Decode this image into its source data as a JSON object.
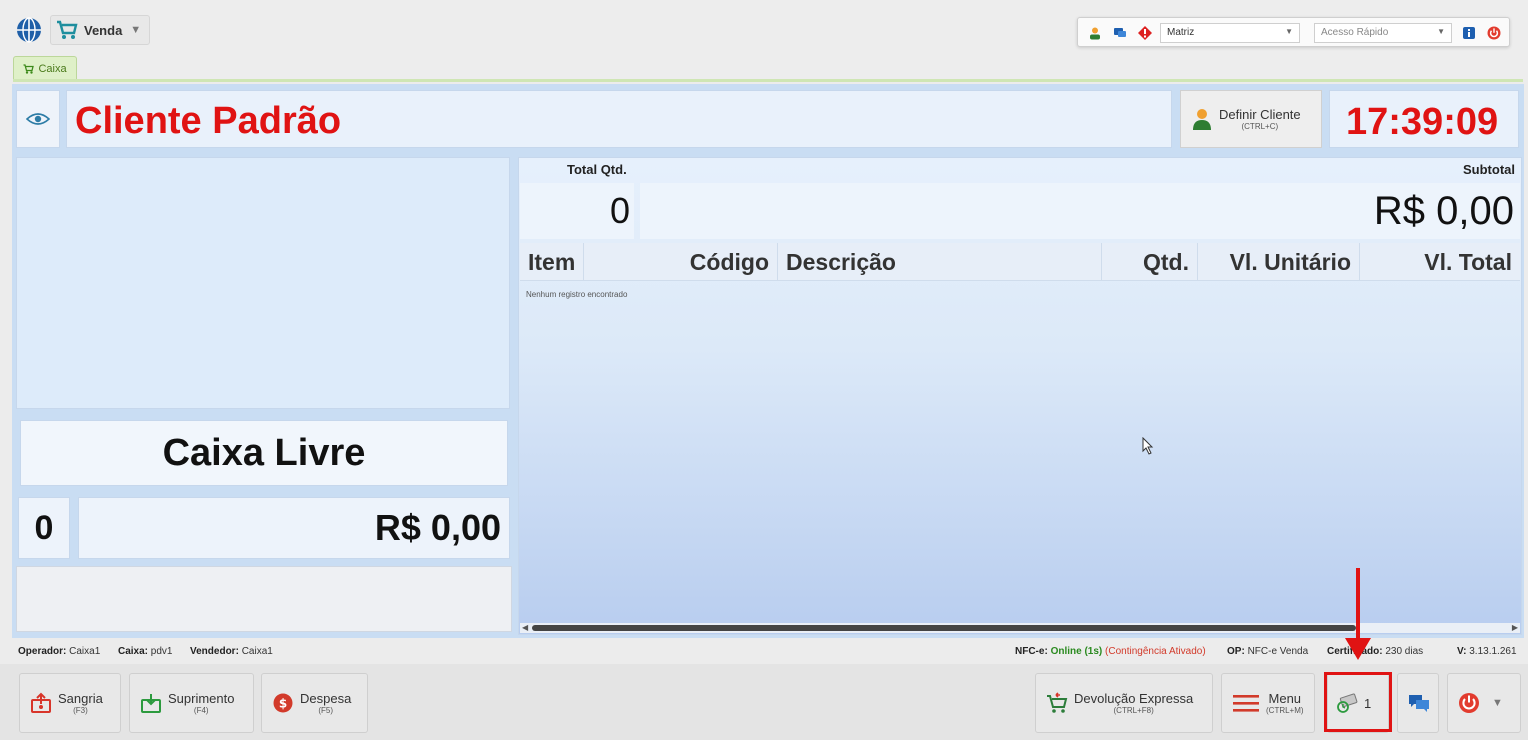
{
  "header": {
    "module_label": "Venda",
    "tab_label": "Caixa",
    "company_select": "Matriz",
    "quick_access_placeholder": "Acesso Rápido"
  },
  "client": {
    "name": "Cliente Padrão",
    "define_label": "Definir Cliente",
    "define_shortcut": "(CTRL+C)",
    "clock": "17:39:09"
  },
  "left": {
    "status": "Caixa Livre",
    "count": "0",
    "total": "R$ 0,00"
  },
  "summary": {
    "total_qtd_label": "Total Qtd.",
    "total_qtd_value": "0",
    "subtotal_label": "Subtotal",
    "subtotal_value": "R$ 0,00"
  },
  "grid": {
    "columns": [
      "Item",
      "Código",
      "Descrição",
      "Qtd.",
      "Vl. Unitário",
      "Vl. Total"
    ],
    "empty_message": "Nenhum registro encontrado"
  },
  "status_bar": {
    "operador_label": "Operador:",
    "operador_value": "Caixa1",
    "caixa_label": "Caixa:",
    "caixa_value": "pdv1",
    "vendedor_label": "Vendedor:",
    "vendedor_value": "Caixa1",
    "nfce_label": "NFC-e:",
    "nfce_status": "Online (1s)",
    "nfce_contingency": "(Contingência Ativado)",
    "op_label": "OP:",
    "op_value": "NFC-e Venda",
    "cert_label": "Certificado:",
    "cert_value": "230 dias",
    "version_label": "V:",
    "version_value": "3.13.1.261"
  },
  "actions": {
    "sangria_label": "Sangria",
    "sangria_key": "(F3)",
    "suprimento_label": "Suprimento",
    "suprimento_key": "(F4)",
    "despesa_label": "Despesa",
    "despesa_key": "(F5)",
    "devolucao_label": "Devolução Expressa",
    "devolucao_key": "(CTRL+F8)",
    "menu_label": "Menu",
    "menu_key": "(CTRL+M)",
    "pending_count": "1"
  },
  "colors": {
    "accent_red": "#e01313",
    "panel_blue": "#c9ddf3",
    "online_green": "#2a8a1f"
  }
}
